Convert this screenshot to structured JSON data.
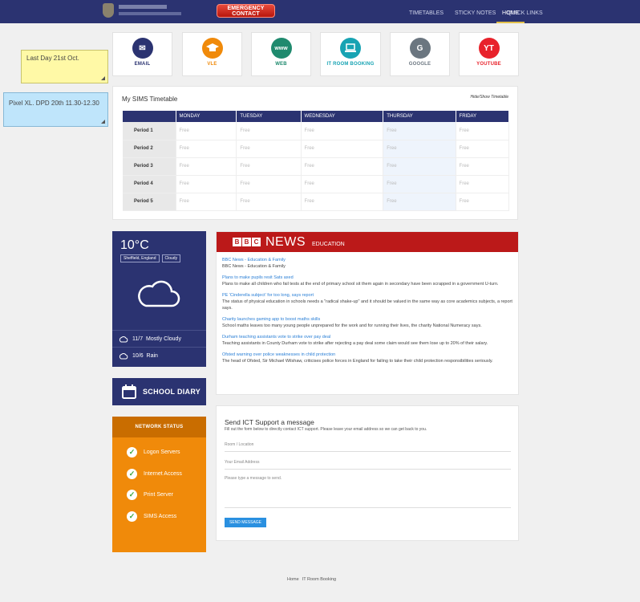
{
  "header": {
    "emergency_label": "EMERGENCY CONTACT",
    "nav": [
      "HOME",
      "TIMETABLES",
      "STICKY NOTES",
      "QUICK LINKS"
    ],
    "active_nav": "HOME"
  },
  "sticky_notes": [
    {
      "text": "Last Day 21st Oct.",
      "color": "#fff9a6"
    },
    {
      "text": "Pixel XL. DPD 20th 11.30-12.30",
      "color": "#bfe5fb"
    }
  ],
  "quick_links": [
    {
      "label": "EMAIL",
      "icon": "envelope-icon",
      "glyph": "✉",
      "color": "#2b3371"
    },
    {
      "label": "VLE",
      "icon": "graduation-cap-icon",
      "glyph": "🎓",
      "color": "#f08a0a"
    },
    {
      "label": "WEB",
      "icon": "www-icon",
      "glyph": "www",
      "color": "#1f8a6e"
    },
    {
      "label": "IT ROOM BOOKING",
      "icon": "laptop-icon",
      "glyph": "💻",
      "color": "#17a3b3"
    },
    {
      "label": "GOOGLE",
      "icon": "google-icon",
      "glyph": "G",
      "color": "#6b7680"
    },
    {
      "label": "YOUTUBE",
      "icon": "youtube-icon",
      "glyph": "YT",
      "color": "#e8222b"
    }
  ],
  "timetable": {
    "title": "My SIMS Timetable",
    "toggle_label": "Hide/Show Timetable",
    "days": [
      "MONDAY",
      "TUESDAY",
      "WEDNESDAY",
      "THURSDAY",
      "FRIDAY"
    ],
    "periods": [
      "Period 1",
      "Period 2",
      "Period 3",
      "Period 4",
      "Period 5"
    ],
    "cell_value": "Free",
    "highlight_day": "THURSDAY"
  },
  "weather": {
    "temp": "10°C",
    "location": "Sheffield, England",
    "condition": "Cloudy",
    "forecast": [
      {
        "text": "11/7  Mostly Cloudy",
        "icon": "cloud-icon"
      },
      {
        "text": "10/6  Rain",
        "icon": "cloud-icon"
      }
    ]
  },
  "diary": {
    "label": "SCHOOL DIARY",
    "icon": "calendar-icon"
  },
  "network": {
    "title": "NETWORK STATUS",
    "items": [
      "Logon Servers",
      "Internet Access",
      "Print Server",
      "SIMS Access"
    ]
  },
  "news": {
    "brand": [
      "B",
      "B",
      "C"
    ],
    "word": "NEWS",
    "section": "EDUCATION",
    "items": [
      {
        "title": "BBC News - Education & Family",
        "desc": "BBC News - Education & Family"
      },
      {
        "title": "Plans to make pupils resit Sats axed",
        "desc": "Plans to make all children who fail tests at the end of primary school sit them again in secondary have been scrapped in a government U-turn."
      },
      {
        "title": "PE 'Cinderella subject' for too long, says report",
        "desc": "The status of physical education in schools needs a \"radical shake-up\" and it should be valued in the same way as core academics subjects, a report says."
      },
      {
        "title": "Charity launches gaming app to boost maths skills",
        "desc": "School maths leaves too many young people unprepared for the work and for running their lives, the charity National Numeracy says."
      },
      {
        "title": "Durham teaching assistants vote to strike over pay deal",
        "desc": "Teaching assistants in County Durham vote to strike after rejecting a pay deal some claim would see them lose up to 20% of their salary."
      },
      {
        "title": "Ofsted warning over police weaknesses in child protection",
        "desc": "The head of Ofsted, Sir Michael Wilshaw, criticises police forces in England for failing to take their child protection responsibilities seriously."
      }
    ]
  },
  "ict_form": {
    "title": "Send ICT Support a message",
    "subtitle": "Fill out the form below to directly contact ICT support. Please leave your email address so we can get back to you.",
    "room_placeholder": "Room / Location",
    "email_placeholder": "Your Email Address",
    "message_placeholder": "Please type a message to send.",
    "send_label": "SEND MESSAGE"
  },
  "footer": {
    "links": [
      "Home",
      "IT Room Booking"
    ]
  }
}
